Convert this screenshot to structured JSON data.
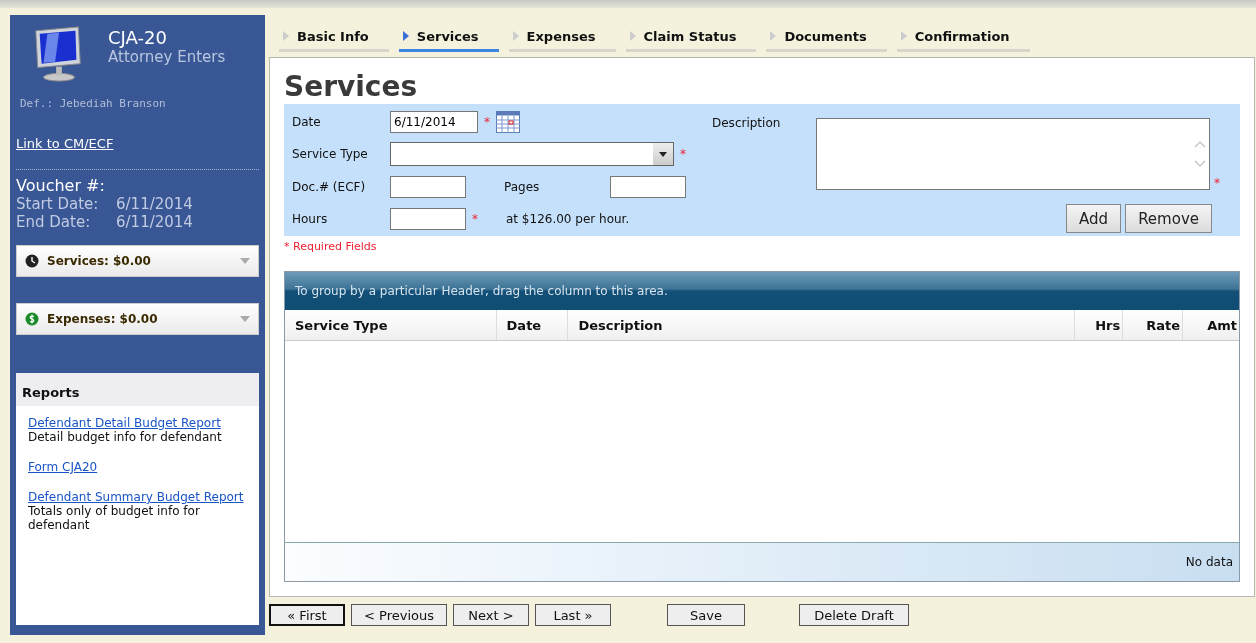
{
  "sidebar": {
    "title": "CJA-20",
    "subtitle": "Attorney Enters",
    "defendant": "Def.: Jebediah Branson",
    "link": "Link to CM/ECF",
    "voucher_label": "Voucher #:",
    "dates": [
      {
        "label": "Start Date:",
        "value": "6/11/2014"
      },
      {
        "label": "End Date:",
        "value": "6/11/2014"
      }
    ],
    "summaries": [
      {
        "kind": "services",
        "label": "Services: $0.00"
      },
      {
        "kind": "expenses",
        "label": "Expenses: $0.00"
      }
    ],
    "reports": {
      "title": "Reports",
      "items": [
        {
          "link": "Defendant Detail Budget Report",
          "description": "Detail budget info for defendant"
        },
        {
          "link": "Form CJA20"
        },
        {
          "link": "Defendant Summary Budget Report",
          "description": "Totals only of budget info for defendant"
        }
      ]
    }
  },
  "tabs": [
    {
      "label": "Basic Info",
      "selected": false
    },
    {
      "label": "Services",
      "selected": true
    },
    {
      "label": "Expenses",
      "selected": false
    },
    {
      "label": "Claim Status",
      "selected": false
    },
    {
      "label": "Documents",
      "selected": false
    },
    {
      "label": "Confirmation",
      "selected": false
    }
  ],
  "heading": "Services",
  "form": {
    "date": {
      "label": "Date",
      "value": "6/11/2014"
    },
    "service_type": {
      "label": "Service Type"
    },
    "doc": {
      "label": "Doc.# (ECF)"
    },
    "pages": {
      "label": "Pages"
    },
    "hours": {
      "label": "Hours"
    },
    "rate": "at $126.00 per hour.",
    "description": {
      "label": "Description"
    },
    "required_mark": "*",
    "required_note": "* Required Fields",
    "actions": [
      "Add",
      "Remove"
    ]
  },
  "grid": {
    "group_hint": "To group by a particular Header, drag the column to this area.",
    "columns": [
      "Service Type",
      "Date",
      "Description",
      "Hrs",
      "Rate",
      "Amt"
    ],
    "footer": "No data"
  },
  "buttons": [
    {
      "label": "« First",
      "focused": true
    },
    {
      "label": "< Previous",
      "focused": false
    },
    {
      "label": "Next >",
      "focused": false
    },
    {
      "label": "Last »",
      "focused": false
    },
    {
      "label": "Save",
      "focused": false
    },
    {
      "label": "Delete Draft",
      "focused": false
    }
  ]
}
